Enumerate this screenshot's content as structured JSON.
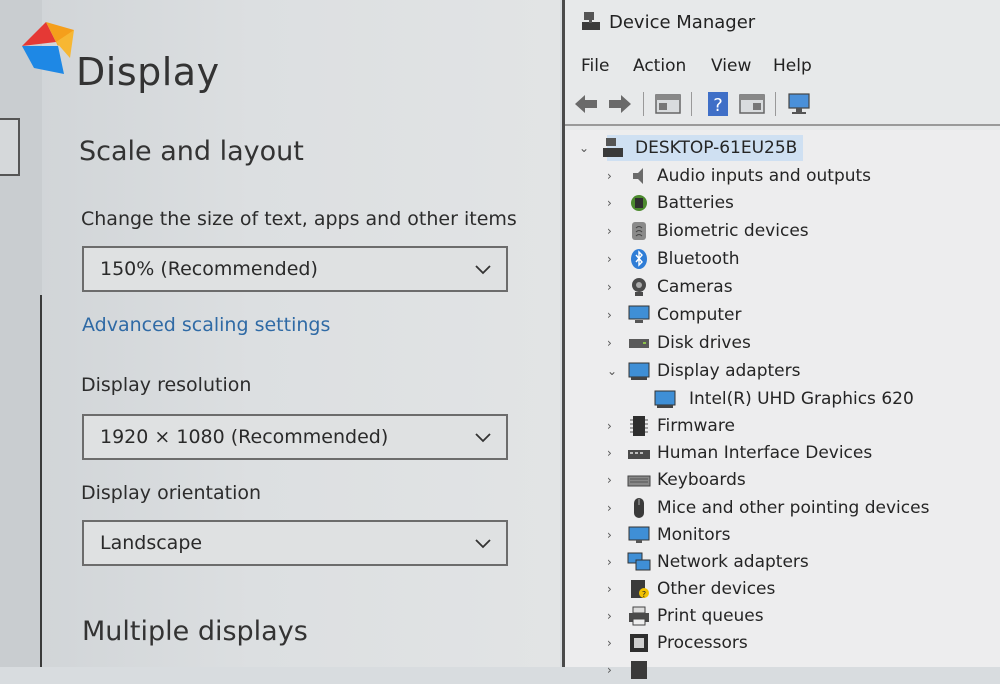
{
  "settings": {
    "page_title": "Display",
    "scale_section_title": "Scale and layout",
    "scale_label": "Change the size of text, apps and other items",
    "scale_value": "150% (Recommended)",
    "advanced_link": "Advanced scaling settings",
    "resolution_label": "Display resolution",
    "resolution_value": "1920 × 1080 (Recommended)",
    "orientation_label": "Display orientation",
    "orientation_value": "Landscape",
    "multiple_displays_title": "Multiple displays"
  },
  "device_manager": {
    "title": "Device Manager",
    "menu": [
      "File",
      "Action",
      "View",
      "Help"
    ],
    "toolbar_icons": [
      "back-icon",
      "forward-icon",
      "properties-icon",
      "help-icon",
      "update-driver-icon",
      "scan-hardware-icon"
    ],
    "root": "DESKTOP-61EU25B",
    "items": [
      {
        "label": "Audio inputs and outputs",
        "icon": "speaker-icon",
        "expanded": false
      },
      {
        "label": "Batteries",
        "icon": "battery-icon",
        "expanded": false
      },
      {
        "label": "Biometric devices",
        "icon": "fingerprint-icon",
        "expanded": false
      },
      {
        "label": "Bluetooth",
        "icon": "bluetooth-icon",
        "expanded": false
      },
      {
        "label": "Cameras",
        "icon": "camera-icon",
        "expanded": false
      },
      {
        "label": "Computer",
        "icon": "computer-icon",
        "expanded": false
      },
      {
        "label": "Disk drives",
        "icon": "disk-icon",
        "expanded": false
      },
      {
        "label": "Display adapters",
        "icon": "display-adapter-icon",
        "expanded": true
      },
      {
        "label": "Intel(R) UHD Graphics 620",
        "icon": "display-adapter-icon",
        "child": true
      },
      {
        "label": "Firmware",
        "icon": "firmware-icon",
        "expanded": false
      },
      {
        "label": "Human Interface Devices",
        "icon": "hid-icon",
        "expanded": false
      },
      {
        "label": "Keyboards",
        "icon": "keyboard-icon",
        "expanded": false
      },
      {
        "label": "Mice and other pointing devices",
        "icon": "mouse-icon",
        "expanded": false
      },
      {
        "label": "Monitors",
        "icon": "monitor-icon",
        "expanded": false
      },
      {
        "label": "Network adapters",
        "icon": "network-icon",
        "expanded": false
      },
      {
        "label": "Other devices",
        "icon": "unknown-device-icon",
        "expanded": false
      },
      {
        "label": "Print queues",
        "icon": "printer-icon",
        "expanded": false
      },
      {
        "label": "Processors",
        "icon": "processor-icon",
        "expanded": false
      }
    ]
  },
  "colors": {
    "link": "#2f6aa5",
    "selection": "#cfe0f2",
    "monitor_blue": "#3f8fd6"
  }
}
